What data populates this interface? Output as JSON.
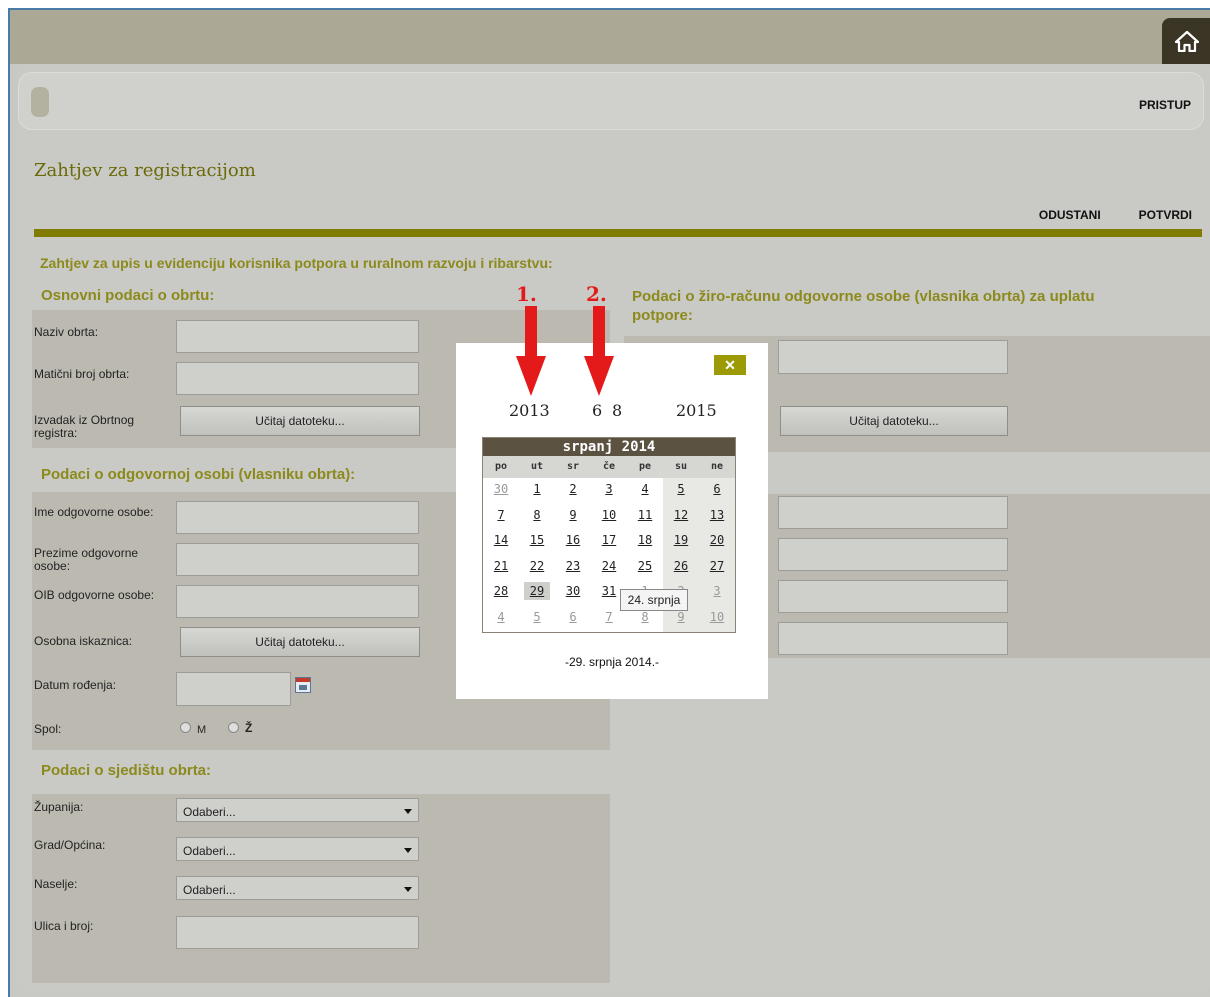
{
  "topbar": {
    "home_icon": "home-icon"
  },
  "nav": {
    "right_link": "PRISTUP"
  },
  "page": {
    "title": "Zahtjev za registracijom"
  },
  "actions": {
    "cancel": "ODUSTANI",
    "confirm": "POTVRDI"
  },
  "form": {
    "heading": "Zahtjev za upis u evidenciju korisnika potpora u ruralnom razvoju i ribarstvu:",
    "basic": {
      "title": "Osnovni podaci o obrtu:",
      "naziv": "Naziv obrta:",
      "maticni": "Matični broj obrta:",
      "izvadak": "Izvadak iz Obrtnog registra:",
      "upload": "Učitaj datoteku..."
    },
    "person": {
      "title": "Podaci o odgovornoj osobi (vlasniku obrta):",
      "ime": "Ime odgovorne osobe:",
      "prezime": "Prezime odgovorne osobe:",
      "oib": "OIB odgovorne osobe:",
      "iskaznica": "Osobna iskaznica:",
      "upload": "Učitaj datoteku...",
      "datum": "Datum rođenja:",
      "spol": "Spol:",
      "spol_m": "M",
      "spol_z": "Ž"
    },
    "seat": {
      "title": "Podaci o sjedištu obrta:",
      "zupanija": "Županija:",
      "grad": "Grad/Općina:",
      "naselje": "Naselje:",
      "ulica": "Ulica i broj:",
      "select_placeholder": "Odaberi..."
    },
    "bank": {
      "title": "Podaci o žiro-računu odgovorne osobe (vlasnika obrta) za uplatu potpore:",
      "upload": "Učitaj datoteku..."
    }
  },
  "calendar_popup": {
    "close": "✕",
    "year_prev": "2013",
    "month_prev": "6",
    "month_next": "8",
    "year_next": "2015",
    "month_year": "srpanj 2014",
    "weekdays": [
      "po",
      "ut",
      "sr",
      "če",
      "pe",
      "su",
      "ne"
    ],
    "weeks": [
      [
        "30",
        "1",
        "2",
        "3",
        "4",
        "5",
        "6"
      ],
      [
        "7",
        "8",
        "9",
        "10",
        "11",
        "12",
        "13"
      ],
      [
        "14",
        "15",
        "16",
        "17",
        "18",
        "19",
        "20"
      ],
      [
        "21",
        "22",
        "23",
        "24",
        "25",
        "26",
        "27"
      ],
      [
        "28",
        "29",
        "30",
        "31",
        "1",
        "2",
        "3"
      ],
      [
        "4",
        "5",
        "6",
        "7",
        "8",
        "9",
        "10"
      ]
    ],
    "selected_day": "29",
    "tooltip": "24. srpnja",
    "footer_date": "-29. srpnja 2014.-"
  },
  "annotations": {
    "marker_1": "1.",
    "marker_2": "2."
  },
  "colors": {
    "accent": "#807b04",
    "section_title": "#8c8a1c",
    "annotation": "#e41a1a"
  }
}
